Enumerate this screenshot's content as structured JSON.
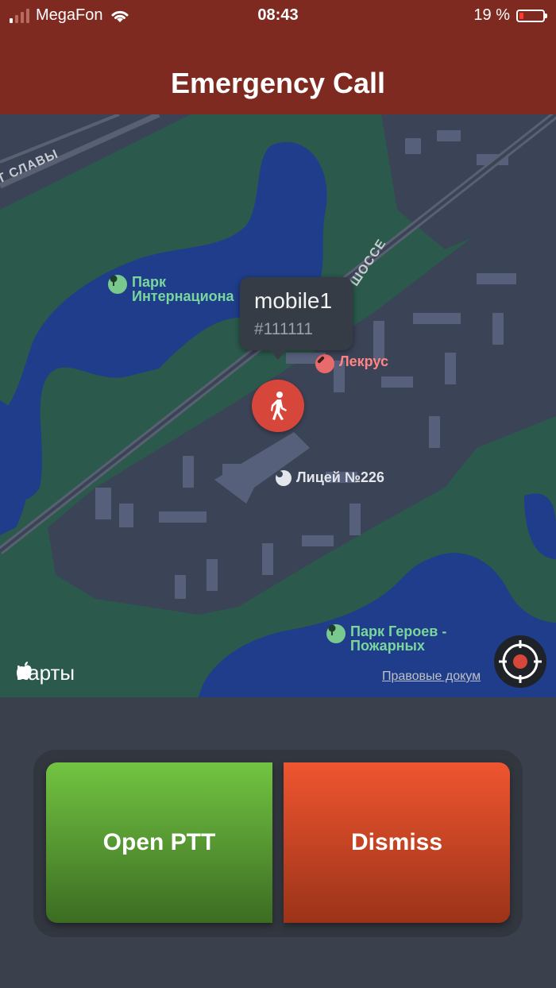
{
  "status_bar": {
    "carrier": "MegaFon",
    "time": "08:43",
    "battery": "19 %",
    "battery_level": 0.19
  },
  "header": {
    "title": "Emergency Call"
  },
  "map": {
    "road_labels": [
      "Т СЛАВЫ",
      "ШОССЕ"
    ],
    "pois": [
      {
        "name": "Парк\nИнтернациона",
        "type": "park"
      },
      {
        "name": "Лекрус",
        "type": "pharmacy"
      },
      {
        "name": "Лицей №226",
        "type": "school"
      },
      {
        "name": "Парк Героев -\nПожарных",
        "type": "park"
      }
    ],
    "callout": {
      "name": "mobile1",
      "number": "#111111"
    },
    "brand": "Карты",
    "legal": "Правовые докум",
    "colors": {
      "water": "#1f3d8a",
      "land": "#2b5a4d",
      "urban": "#3b4356",
      "pin": "#d7463b"
    }
  },
  "actions": {
    "open_ptt": "Open PTT",
    "dismiss": "Dismiss"
  },
  "colors": {
    "header": "#7e2a20",
    "ptt": "#4f8f2c",
    "dismiss": "#d94a26"
  }
}
